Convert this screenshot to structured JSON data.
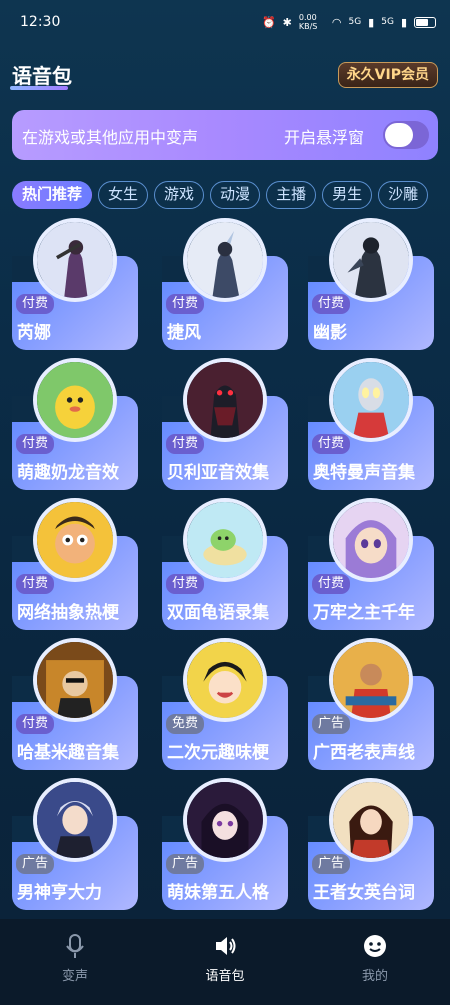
{
  "status": {
    "time": "12:30",
    "net": "0.00 KB/S",
    "sig1": "5G",
    "sig2": "5G"
  },
  "header": {
    "title": "语音包",
    "vip": "永久VIP会员"
  },
  "float_bar": {
    "text": "在游戏或其他应用中变声",
    "toggle_label": "开启悬浮窗",
    "toggle_on": false
  },
  "tabs": [
    "热门推荐",
    "女生",
    "游戏",
    "动漫",
    "主播",
    "男生",
    "沙雕"
  ],
  "cards": [
    {
      "name": "芮娜",
      "tag": "付费"
    },
    {
      "name": "捷风",
      "tag": "付费"
    },
    {
      "name": "幽影",
      "tag": "付费"
    },
    {
      "name": "萌趣奶龙音效",
      "tag": "付费"
    },
    {
      "name": "贝利亚音效集",
      "tag": "付费"
    },
    {
      "name": "奥特曼声音集",
      "tag": "付费"
    },
    {
      "name": "网络抽象热梗",
      "tag": "付费"
    },
    {
      "name": "双面龟语录集",
      "tag": "付费"
    },
    {
      "name": "万牢之主千年",
      "tag": "付费"
    },
    {
      "name": "哈基米趣音集",
      "tag": "付费"
    },
    {
      "name": "二次元趣味梗",
      "tag": "免费"
    },
    {
      "name": "广西老表声线",
      "tag": "广告"
    },
    {
      "name": "男神亨大力",
      "tag": "广告"
    },
    {
      "name": "萌妹第五人格",
      "tag": "广告"
    },
    {
      "name": "王者女英台词",
      "tag": "广告"
    }
  ],
  "nav": {
    "voice_change": "变声",
    "voice_pack": "语音包",
    "mine": "我的"
  },
  "colors": {
    "accent": "#8a7bff",
    "card": "#6f8dff",
    "bg": "#0c2c46"
  }
}
